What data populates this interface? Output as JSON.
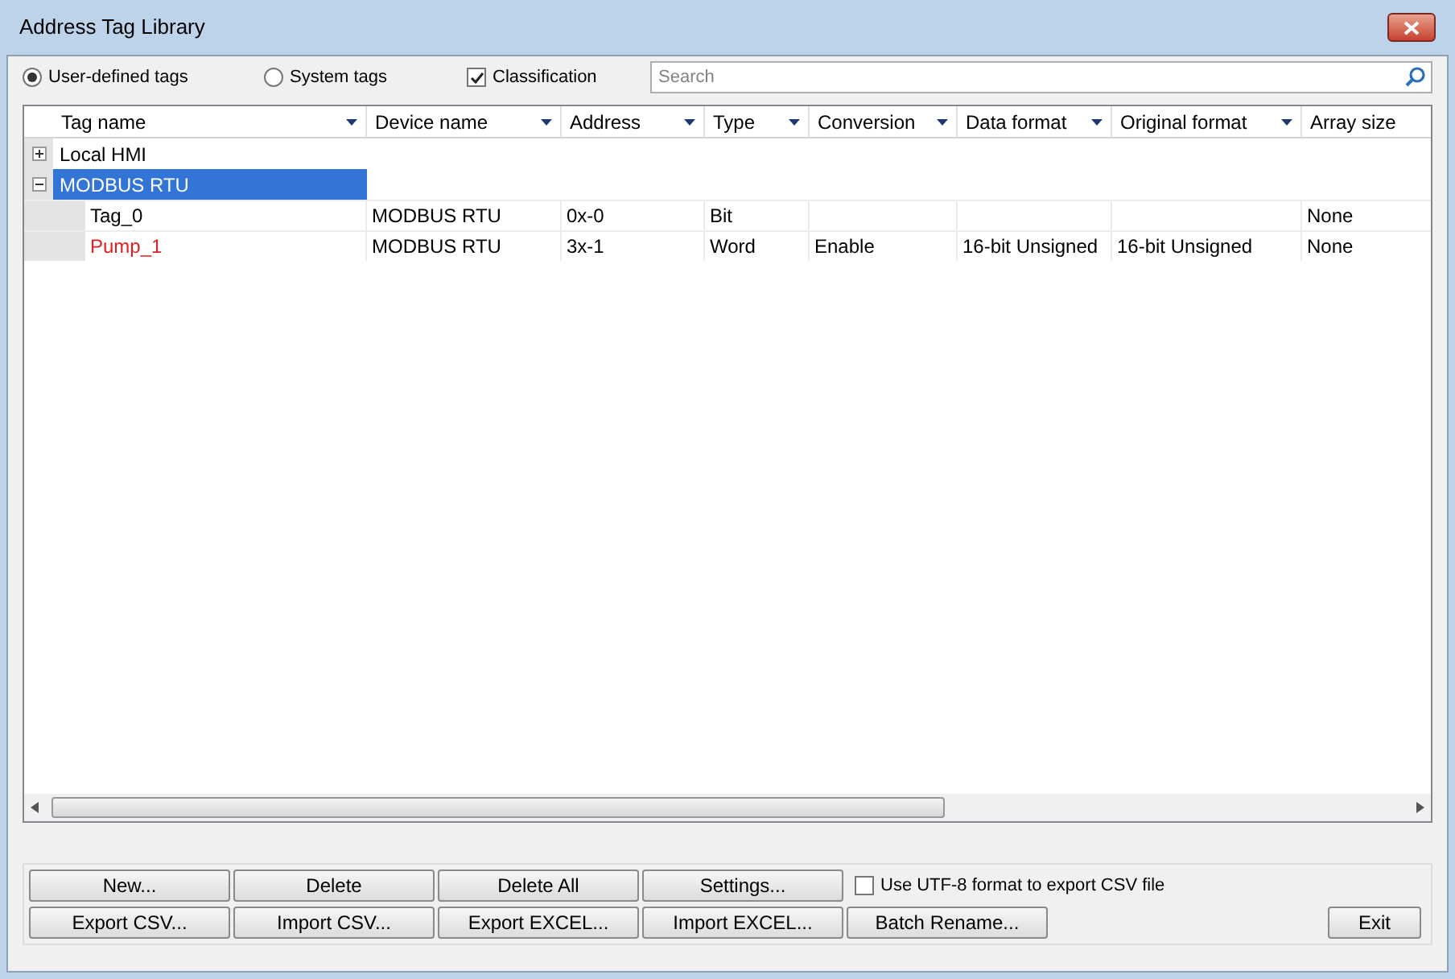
{
  "window": {
    "title": "Address Tag Library"
  },
  "filters": [
    {
      "kind": "radio",
      "label": "User-defined tags",
      "selected": true
    },
    {
      "kind": "radio",
      "label": "System tags",
      "selected": false
    },
    {
      "kind": "checkbox",
      "label": "Classification",
      "checked": true
    }
  ],
  "search": {
    "placeholder": "Search"
  },
  "table": {
    "columns": [
      "Tag name",
      "Device name",
      "Address",
      "Type",
      "Conversion",
      "Data format",
      "Original format",
      "Array size"
    ],
    "groups": [
      {
        "name": "Local HMI",
        "expanded": false,
        "selected": false
      },
      {
        "name": "MODBUS RTU",
        "expanded": true,
        "selected": true,
        "rows": [
          {
            "cells": [
              "Tag_0",
              "MODBUS RTU",
              "0x-0",
              "Bit",
              "",
              "",
              "",
              "None"
            ],
            "color": "#000000"
          },
          {
            "cells": [
              "Pump_1",
              "MODBUS RTU",
              "3x-1",
              "Word",
              "Enable",
              "16-bit Unsigned",
              "16-bit Unsigned",
              "None"
            ],
            "color": "#e02020"
          }
        ]
      }
    ]
  },
  "buttons_row_1": [
    "New...",
    "Delete",
    "Delete All",
    "Settings..."
  ],
  "utf8_option": {
    "label": "Use UTF-8 format to export CSV file",
    "checked": false
  },
  "buttons_row_2": [
    "Export CSV...",
    "Import CSV...",
    "Export EXCEL...",
    "Import EXCEL...",
    "Batch Rename..."
  ],
  "exit_button": "Exit"
}
